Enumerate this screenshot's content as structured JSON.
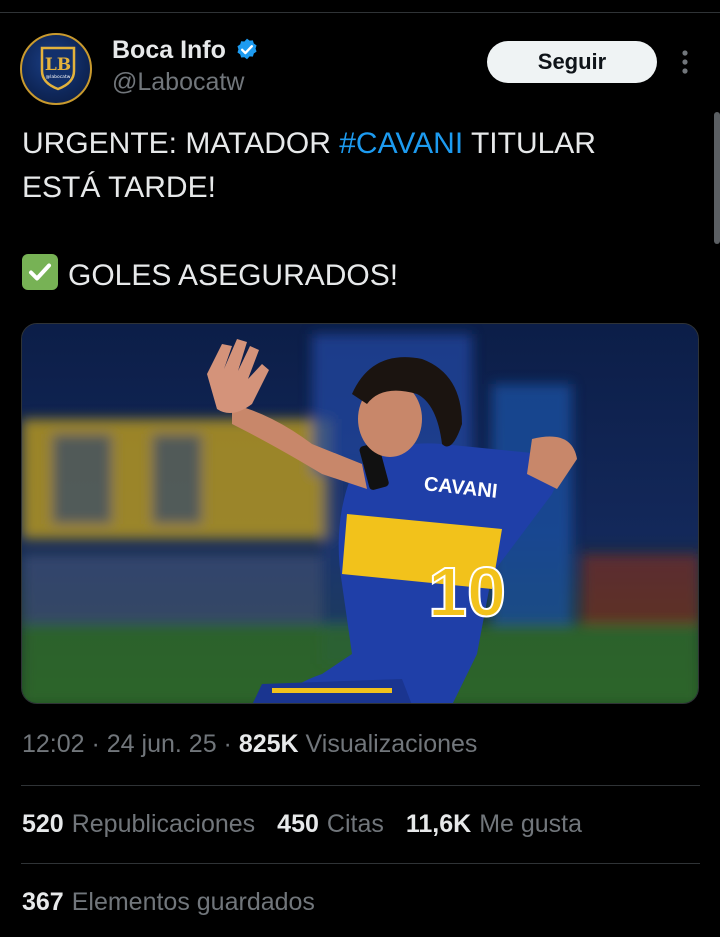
{
  "author": {
    "display_name": "Boca Info",
    "handle": "@Labocatw",
    "avatar_text": "LB",
    "avatar_subtext": "@labocatw",
    "verified_icon": "verified-badge-icon",
    "colors": {
      "verified": "#1d9bf0",
      "avatar_bg": "#0e2658",
      "avatar_ring": "#c99a2e"
    }
  },
  "actions": {
    "follow_label": "Seguir",
    "more_icon": "more-vertical-icon"
  },
  "tweet": {
    "line1_prefix": "URGENTE: MATADOR ",
    "hashtag": "#CAVANI",
    "line1_suffix": " TITULAR",
    "line2": "ESTÁ TARDE!",
    "check_icon": "check-mark-button-emoji",
    "line3": "GOLES ASEGURADOS!",
    "colors": {
      "hashtag": "#1d9bf0",
      "text": "#e7e9ea"
    }
  },
  "media": {
    "shirt_name": "CAVANI",
    "shirt_number": "10"
  },
  "meta": {
    "time": "12:02",
    "sep1": " · ",
    "date": "24 jun. 25",
    "sep2": " · ",
    "views_count": "825K",
    "views_label": " Visualizaciones"
  },
  "stats": [
    {
      "count": "520",
      "label": "Republicaciones"
    },
    {
      "count": "450",
      "label": "Citas"
    },
    {
      "count": "11,6K",
      "label": "Me gusta"
    }
  ],
  "saved": {
    "count": "367",
    "label": "Elementos guardados"
  }
}
